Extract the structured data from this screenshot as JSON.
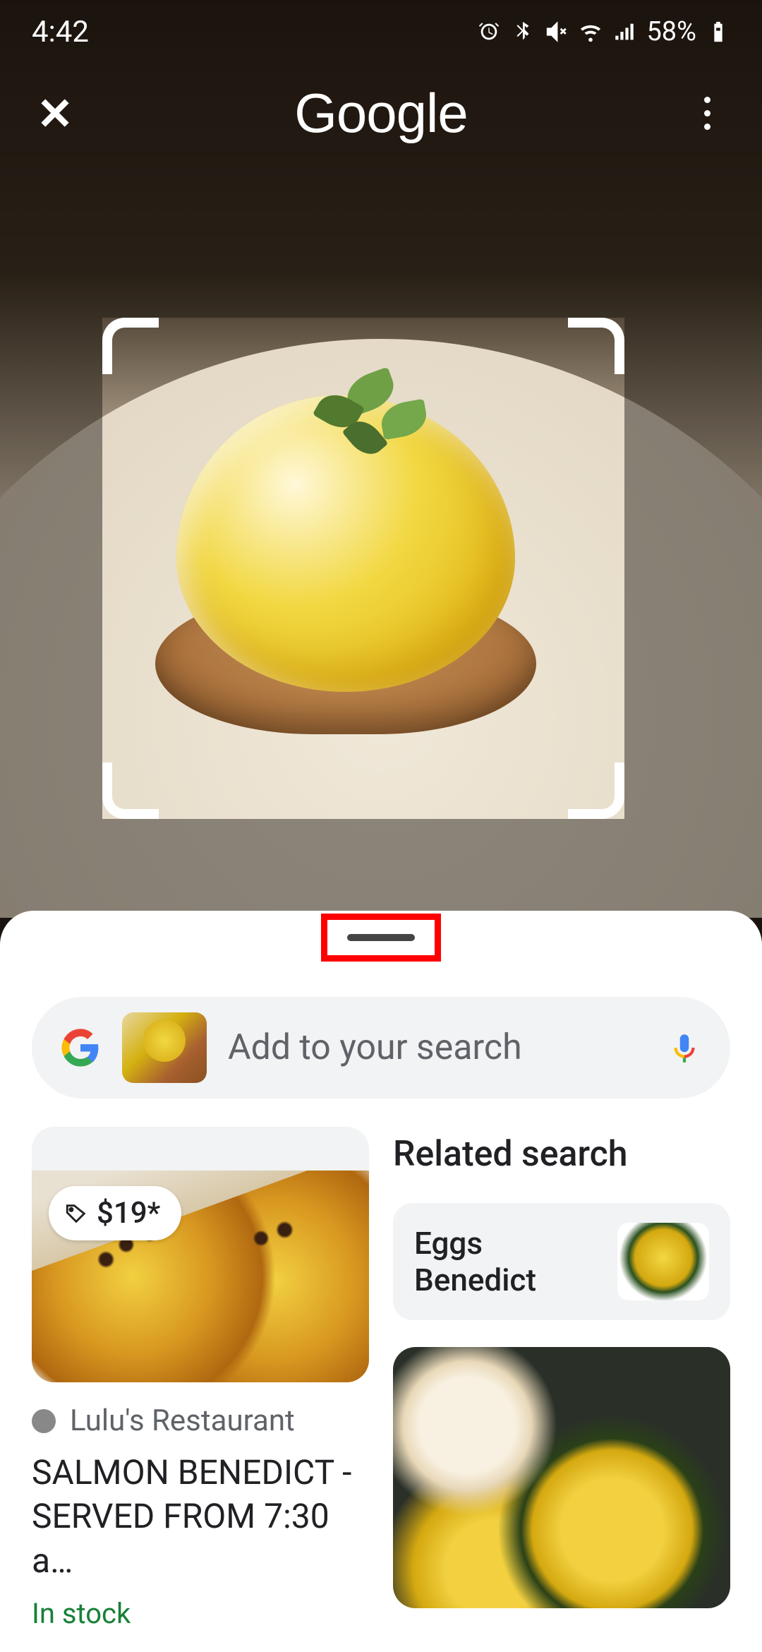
{
  "status": {
    "time": "4:42",
    "battery_text": "58%"
  },
  "header": {
    "logo": "Google"
  },
  "search": {
    "placeholder": "Add to your search"
  },
  "results": {
    "left_card": {
      "price": "$19*",
      "source": "Lulu's Restaurant",
      "title": "SALMON BENEDICT - SERVED FROM 7:30 a…",
      "stock": "In stock"
    },
    "related": {
      "heading": "Related search",
      "chip_label": "Eggs Benedict"
    }
  }
}
